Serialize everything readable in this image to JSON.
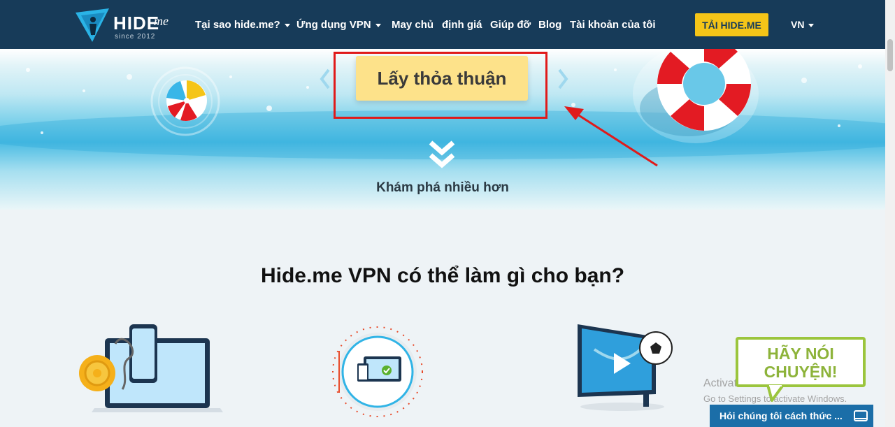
{
  "navbar": {
    "logo": {
      "wordmark": "HIDE",
      "wordmark_suffix": "me",
      "since": "since 2012"
    },
    "items": [
      {
        "label": "Tại sao hide.me?",
        "dropdown": true
      },
      {
        "label": "Ứng dụng VPN",
        "dropdown": true
      },
      {
        "label": "May chủ",
        "dropdown": false
      },
      {
        "label": "định giá",
        "dropdown": false
      },
      {
        "label": "Giúp đỡ",
        "dropdown": false
      },
      {
        "label": "Blog",
        "dropdown": false
      },
      {
        "label": "Tài khoản của tôi",
        "dropdown": false
      }
    ],
    "cta_label": "TẢI HIDE.ME",
    "language": "VN"
  },
  "hero": {
    "deal_button_label": "Lấy thỏa thuận",
    "explore_label": "Khám phá nhiều hơn"
  },
  "section": {
    "title": "Hide.me VPN có thể làm gì cho bạn?"
  },
  "chat": {
    "bubble_line1": "HÃY NÓI",
    "bubble_line2": "CHUYỆN!",
    "bar_label": "Hỏi chúng tôi cách thức ..."
  },
  "watermark": {
    "line1": "Activate Windows",
    "line2": "Go to Settings to activate Windows."
  },
  "colors": {
    "navbar": "#173b59",
    "cta": "#f5c518",
    "deal_button": "#fde28a",
    "highlight": "#e01a1a",
    "chat_green": "#9bc53d",
    "chat_bar": "#1b6ea8"
  }
}
